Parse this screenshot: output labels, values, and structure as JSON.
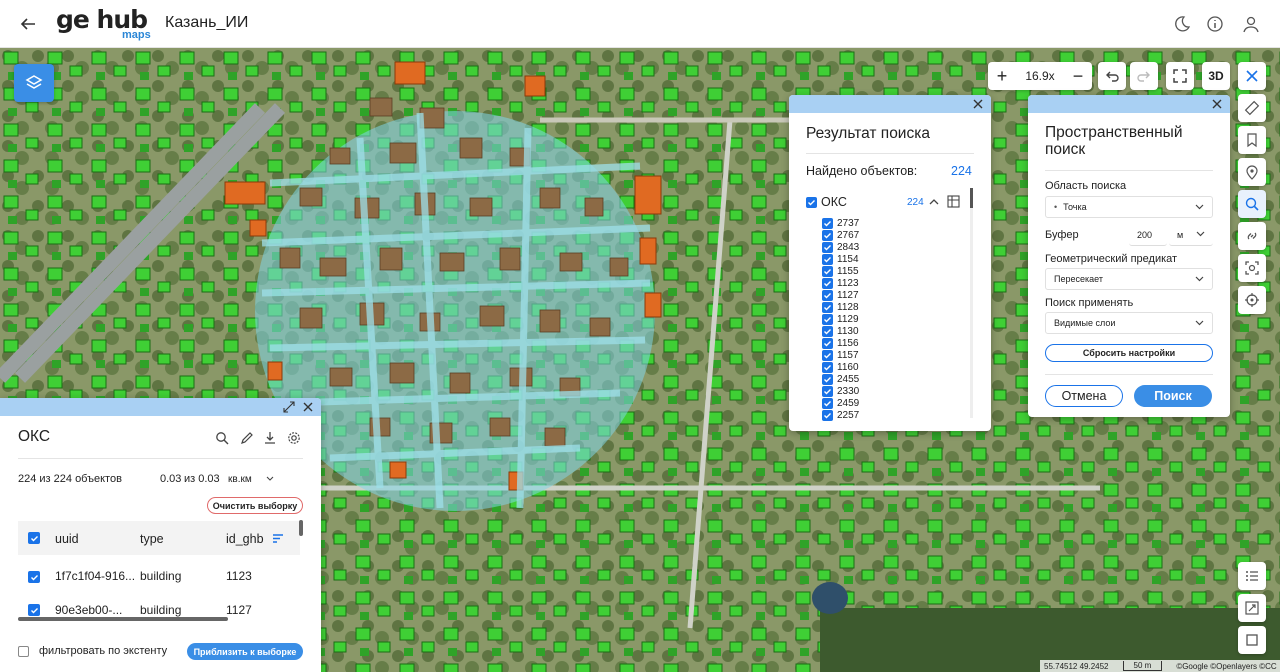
{
  "header": {
    "logo_text": "ge hub",
    "logo_sub": "maps",
    "title": "Казань_ИИ"
  },
  "toolbar": {
    "zoom": "16.9x",
    "btn_3d": "3D"
  },
  "search_result": {
    "title": "Результат поиска",
    "found_label": "Найдено объектов:",
    "found_count": "224",
    "layer": "ОКС",
    "layer_count": "224",
    "ids": [
      "2737",
      "2767",
      "2843",
      "1154",
      "1155",
      "1123",
      "1127",
      "1128",
      "1129",
      "1130",
      "1156",
      "1157",
      "1160",
      "2455",
      "2330",
      "2459",
      "2257"
    ]
  },
  "spatial": {
    "title": "Пространственный поиск",
    "area_label": "Область поиска",
    "area_value": "Точка",
    "buffer_label": "Буфер",
    "buffer_value": "200",
    "buffer_unit": "м",
    "predicate_label": "Геометрический предикат",
    "predicate_value": "Пересекает",
    "apply_label": "Поиск применять",
    "apply_value": "Видимые слои",
    "reset": "Сбросить настройки",
    "cancel": "Отмена",
    "search": "Поиск"
  },
  "layer_panel": {
    "title": "ОКС",
    "count": "224 из 224 объектов",
    "area_val": "0.03",
    "area_of": "из 0.03",
    "area_unit": "кв.км",
    "clear": "Очистить выборку",
    "columns": [
      "uuid",
      "type",
      "id_ghb"
    ],
    "rows": [
      {
        "uuid": "1f7c1f04-916...",
        "type": "building",
        "id": "1123"
      },
      {
        "uuid": "90e3eb00-...",
        "type": "building",
        "id": "1127"
      }
    ],
    "filter": "фильтровать по экстенту",
    "zoom_btn": "Приблизить к выборке"
  },
  "footer": {
    "coords": "55.74512 49.2452",
    "scale": "50 m",
    "attribution": "©Google ©Openlayers ©CC"
  }
}
